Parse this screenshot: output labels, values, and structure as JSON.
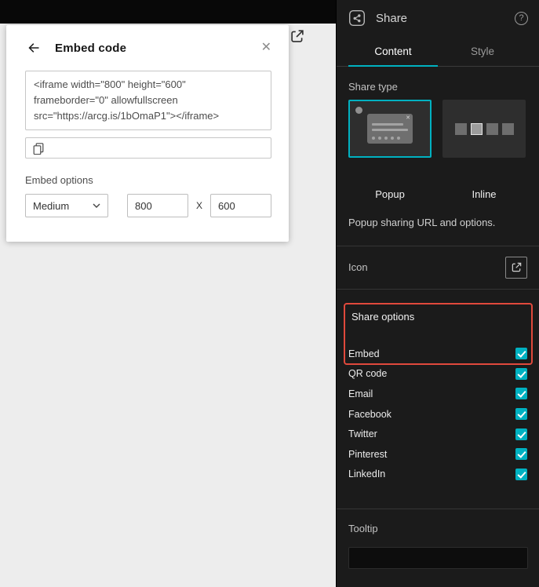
{
  "colors": {
    "accent": "#00b1c1",
    "annotation": "#e0493c"
  },
  "icons": {
    "help": "?",
    "close": "✕",
    "popup_close": "✕"
  },
  "embed_dialog": {
    "title": "Embed code",
    "code": "<iframe width=\"800\" height=\"600\"\nframeborder=\"0\" allowfullscreen\nsrc=\"https://arcg.is/1bOmaP1\"></iframe>",
    "embed_options_label": "Embed options",
    "size_preset": "Medium",
    "width": "800",
    "dimension_separator": "X",
    "height": "600"
  },
  "panel": {
    "title": "Share",
    "tabs": [
      {
        "label": "Content",
        "active": true
      },
      {
        "label": "Style",
        "active": false
      }
    ],
    "share_type": {
      "label": "Share type",
      "options": [
        {
          "label": "Popup",
          "selected": true
        },
        {
          "label": "Inline",
          "selected": false
        }
      ],
      "description": "Popup sharing URL and options."
    },
    "icon_section": {
      "label": "Icon"
    },
    "share_options": {
      "label": "Share options",
      "items": [
        {
          "label": "Embed",
          "checked": true
        },
        {
          "label": "QR code",
          "checked": true
        },
        {
          "label": "Email",
          "checked": true
        },
        {
          "label": "Facebook",
          "checked": true
        },
        {
          "label": "Twitter",
          "checked": true
        },
        {
          "label": "Pinterest",
          "checked": true
        },
        {
          "label": "LinkedIn",
          "checked": true
        }
      ]
    },
    "tooltip": {
      "label": "Tooltip",
      "value": ""
    }
  }
}
